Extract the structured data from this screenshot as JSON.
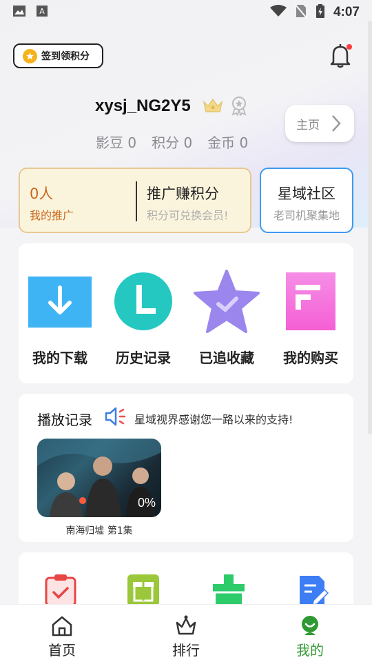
{
  "status_bar": {
    "time": "4:07"
  },
  "header": {
    "checkin_label": "签到领积分",
    "username": "xysj_NG2Y5",
    "stats": {
      "yingdou": "影豆 0",
      "jifen": "积分 0",
      "jinbi": "金币 0"
    },
    "home_button_label": "主页"
  },
  "promo": {
    "count": "0人",
    "count_label": "我的推广",
    "title": "推广赚积分",
    "subtitle": "积分可兑换会员!"
  },
  "community": {
    "title": "星域社区",
    "subtitle": "老司机聚集地"
  },
  "quick_actions": [
    {
      "label": "我的下载",
      "icon": "download-icon",
      "color": "#3fb4f5"
    },
    {
      "label": "历史记录",
      "icon": "history-icon",
      "color": "#25c8c0"
    },
    {
      "label": "已追收藏",
      "icon": "favorite-star-icon",
      "color": "#9b86ee"
    },
    {
      "label": "我的购买",
      "icon": "purchase-icon",
      "color": "#f56fd8"
    }
  ],
  "history": {
    "title": "播放记录",
    "notice": "星域视界感谢您一路以来的支持!",
    "items": [
      {
        "episode": "南海归墟 第1集",
        "progress": "0%"
      }
    ]
  },
  "more_icons": [
    {
      "icon": "clipboard-check-icon",
      "color": "#e84545"
    },
    {
      "icon": "gift-icon",
      "color": "#9bc83a"
    },
    {
      "icon": "toolbox-icon",
      "color": "#2ecb6b"
    },
    {
      "icon": "edit-note-icon",
      "color": "#3d7ef5"
    }
  ],
  "tabbar": [
    {
      "label": "首页",
      "icon": "home-icon"
    },
    {
      "label": "排行",
      "icon": "ranking-crown-icon"
    },
    {
      "label": "我的",
      "icon": "profile-icon",
      "active": true
    }
  ]
}
